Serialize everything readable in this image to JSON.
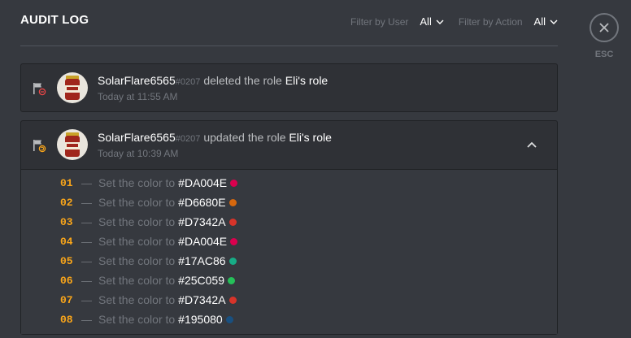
{
  "header": {
    "title": "AUDIT LOG",
    "filter_user_label": "Filter by User",
    "filter_user_value": "All",
    "filter_action_label": "Filter by Action",
    "filter_action_value": "All",
    "esc_label": "ESC"
  },
  "entries": [
    {
      "username": "SolarFlare6565",
      "discriminator": "#0207",
      "action": "deleted the role",
      "target": "Eli's role",
      "timestamp": "Today at 11:55 AM",
      "action_color": "#f04747"
    },
    {
      "username": "SolarFlare6565",
      "discriminator": "#0207",
      "action": "updated the role",
      "target": "Eli's role",
      "timestamp": "Today at 10:39 AM",
      "action_color": "#faa61a",
      "changes": [
        {
          "num": "01",
          "text": "Set the color to",
          "value": "#DA004E",
          "color": "#DA004E"
        },
        {
          "num": "02",
          "text": "Set the color to",
          "value": "#D6680E",
          "color": "#D6680E"
        },
        {
          "num": "03",
          "text": "Set the color to",
          "value": "#D7342A",
          "color": "#D7342A"
        },
        {
          "num": "04",
          "text": "Set the color to",
          "value": "#DA004E",
          "color": "#DA004E"
        },
        {
          "num": "05",
          "text": "Set the color to",
          "value": "#17AC86",
          "color": "#17AC86"
        },
        {
          "num": "06",
          "text": "Set the color to",
          "value": "#25C059",
          "color": "#25C059"
        },
        {
          "num": "07",
          "text": "Set the color to",
          "value": "#D7342A",
          "color": "#D7342A"
        },
        {
          "num": "08",
          "text": "Set the color to",
          "value": "#195080",
          "color": "#195080"
        }
      ]
    }
  ]
}
